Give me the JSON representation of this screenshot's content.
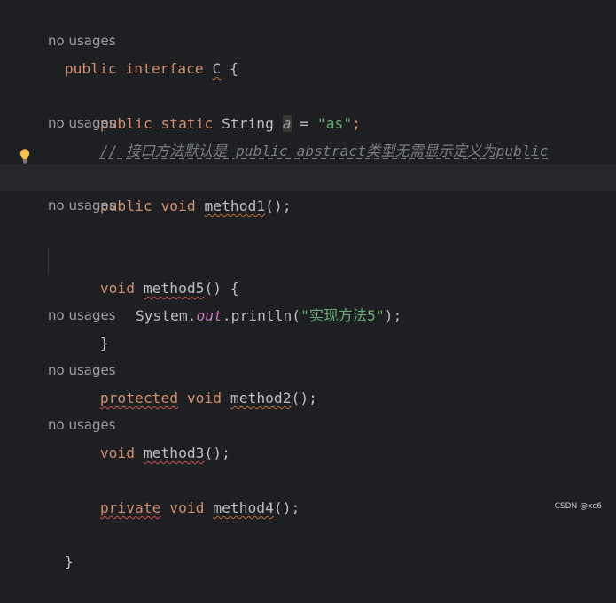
{
  "code": {
    "line1": {
      "t1": "public",
      "t2": " ",
      "t3": "interface",
      "t4": " ",
      "t5": "C",
      "t6": " {"
    },
    "hint1": "no usages",
    "line2": {
      "t1": "public",
      "t2": " ",
      "t3": "static",
      "t4": " String ",
      "t5": "a",
      "t6": " = ",
      "t7": "\"as\"",
      "t8": ";"
    },
    "line3": {
      "t1": "// 接口方法默认是 public abstract类型无需显示定义为public"
    },
    "hint2": "no usages",
    "line4": {
      "t1": "public",
      "t2": " ",
      "t3": "void",
      "t4": " ",
      "t5": "method1",
      "t6": "();"
    },
    "hint3": "no usages",
    "line5": {
      "t1": "void",
      "t2": " ",
      "t3": "method5",
      "t4": "() {"
    },
    "line6": {
      "t1": "System.",
      "t2": "out",
      "t3": ".println(",
      "t4": "\"实现方法5\"",
      "t5": ");"
    },
    "line7": {
      "t1": "}"
    },
    "hint4": "no usages",
    "line8": {
      "t1": "protected",
      "t2": " ",
      "t3": "void",
      "t4": " ",
      "t5": "method2",
      "t6": "();"
    },
    "hint5": "no usages",
    "line9": {
      "t1": "void",
      "t2": " ",
      "t3": "method3",
      "t4": "();"
    },
    "hint6": "no usages",
    "line10": {
      "t1": "private",
      "t2": " ",
      "t3": "void",
      "t4": " ",
      "t5": "method4",
      "t6": "();"
    },
    "line11": {
      "t1": "}"
    }
  },
  "watermark": "CSDN @xc6",
  "colors": {
    "background": "#1e1f22",
    "keyword": "#cf8e6d",
    "string": "#6aab73",
    "comment": "#7a7e85",
    "static_field": "#c77dbb",
    "hint": "#9a9da3"
  },
  "icons": {
    "gutter": "lightbulb-icon"
  }
}
